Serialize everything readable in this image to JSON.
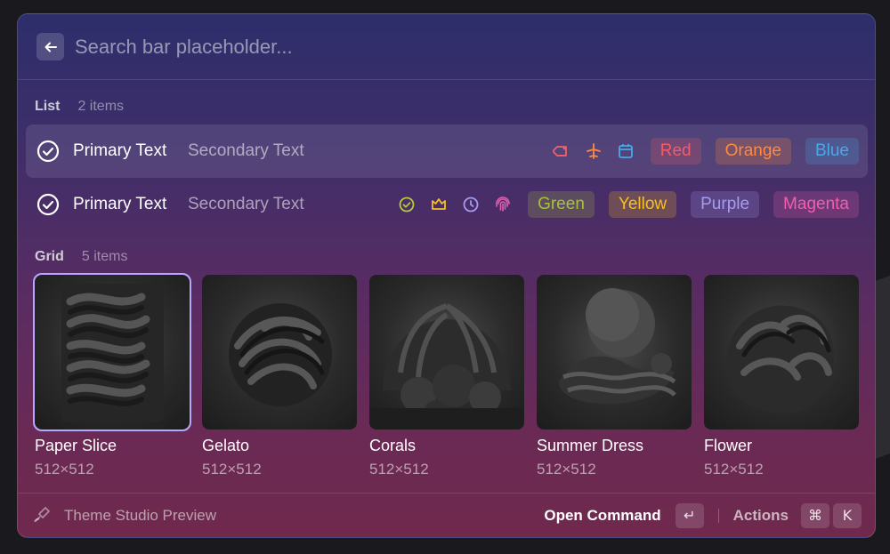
{
  "search": {
    "placeholder": "Search bar placeholder...",
    "back_icon": "arrow-left-icon"
  },
  "list_section": {
    "title": "List",
    "count": "2 items"
  },
  "list_items": [
    {
      "primary": "Primary Text",
      "secondary": "Secondary Text",
      "selected": true,
      "icons": [
        "tag-icon",
        "airplane-icon",
        "calendar-icon"
      ],
      "icon_colors": [
        "#f0606a",
        "#ff8a3d",
        "#4aa8e8"
      ],
      "tags": [
        {
          "label": "Red",
          "color": "#f25c6a",
          "bg": "rgba(242,92,106,0.22)"
        },
        {
          "label": "Orange",
          "color": "#ff8a3d",
          "bg": "rgba(255,138,61,0.22)"
        },
        {
          "label": "Blue",
          "color": "#4aa8e8",
          "bg": "rgba(74,168,232,0.22)"
        }
      ]
    },
    {
      "primary": "Primary Text",
      "secondary": "Secondary Text",
      "selected": false,
      "icons": [
        "check-circle-icon",
        "crown-icon",
        "clock-icon",
        "fingerprint-icon"
      ],
      "icon_colors": [
        "#b5c93a",
        "#f5c020",
        "#a49cf0",
        "#e060b0"
      ],
      "tags": [
        {
          "label": "Green",
          "color": "#a8c040",
          "bg": "rgba(168,192,64,0.22)"
        },
        {
          "label": "Yellow",
          "color": "#f5c020",
          "bg": "rgba(245,192,32,0.22)"
        },
        {
          "label": "Purple",
          "color": "#a49cf0",
          "bg": "rgba(164,156,240,0.22)"
        },
        {
          "label": "Magenta",
          "color": "#ef5fae",
          "bg": "rgba(239,95,174,0.22)"
        }
      ]
    }
  ],
  "grid_section": {
    "title": "Grid",
    "count": "5 items"
  },
  "grid_items": [
    {
      "title": "Paper Slice",
      "subtitle": "512×512",
      "selected": true
    },
    {
      "title": "Gelato",
      "subtitle": "512×512",
      "selected": false
    },
    {
      "title": "Corals",
      "subtitle": "512×512",
      "selected": false
    },
    {
      "title": "Summer Dress",
      "subtitle": "512×512",
      "selected": false
    },
    {
      "title": "Flower",
      "subtitle": "512×512",
      "selected": false
    }
  ],
  "footer": {
    "title": "Theme Studio Preview",
    "icon": "paintbrush-icon",
    "primary_action": "Open Command",
    "primary_key": "↵",
    "actions_label": "Actions",
    "actions_keys": [
      "⌘",
      "K"
    ]
  }
}
